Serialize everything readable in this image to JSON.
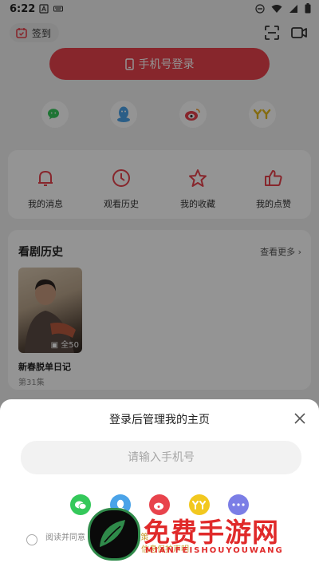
{
  "status_bar": {
    "time": "6:22"
  },
  "header": {
    "signin_label": "签到"
  },
  "login": {
    "button_label": "手机号登录"
  },
  "social_logins": [
    "wechat-icon",
    "qq-icon",
    "weibo-icon",
    "yy-icon"
  ],
  "quick_links": [
    {
      "label": "我的消息",
      "icon": "bell-icon"
    },
    {
      "label": "观看历史",
      "icon": "clock-icon"
    },
    {
      "label": "我的收藏",
      "icon": "star-icon"
    },
    {
      "label": "我的点赞",
      "icon": "thumbs-up-icon"
    }
  ],
  "history": {
    "title": "看剧历史",
    "see_more": "查看更多",
    "items": [
      {
        "title": "新春脱单日记",
        "episode": "第31集",
        "badge": "全50"
      }
    ]
  },
  "login_sheet": {
    "title": "登录后管理我的主页",
    "phone_placeholder": "请输入手机号",
    "agreement_prefix": "阅读并同意",
    "agreement_mid": "及",
    "agreement_link1": "好看",
    "agreement_link2": "隐私政策",
    "agreement_line2": "信息保护声明"
  },
  "watermark": {
    "main": "免费手游网",
    "sub": "MIANFEISHOUYOUWANG"
  },
  "colors": {
    "accent": "#e8434c",
    "wechat": "#34c85a",
    "qq": "#4aa3e8",
    "weibo": "#e8434c",
    "yy": "#f2c81f"
  }
}
